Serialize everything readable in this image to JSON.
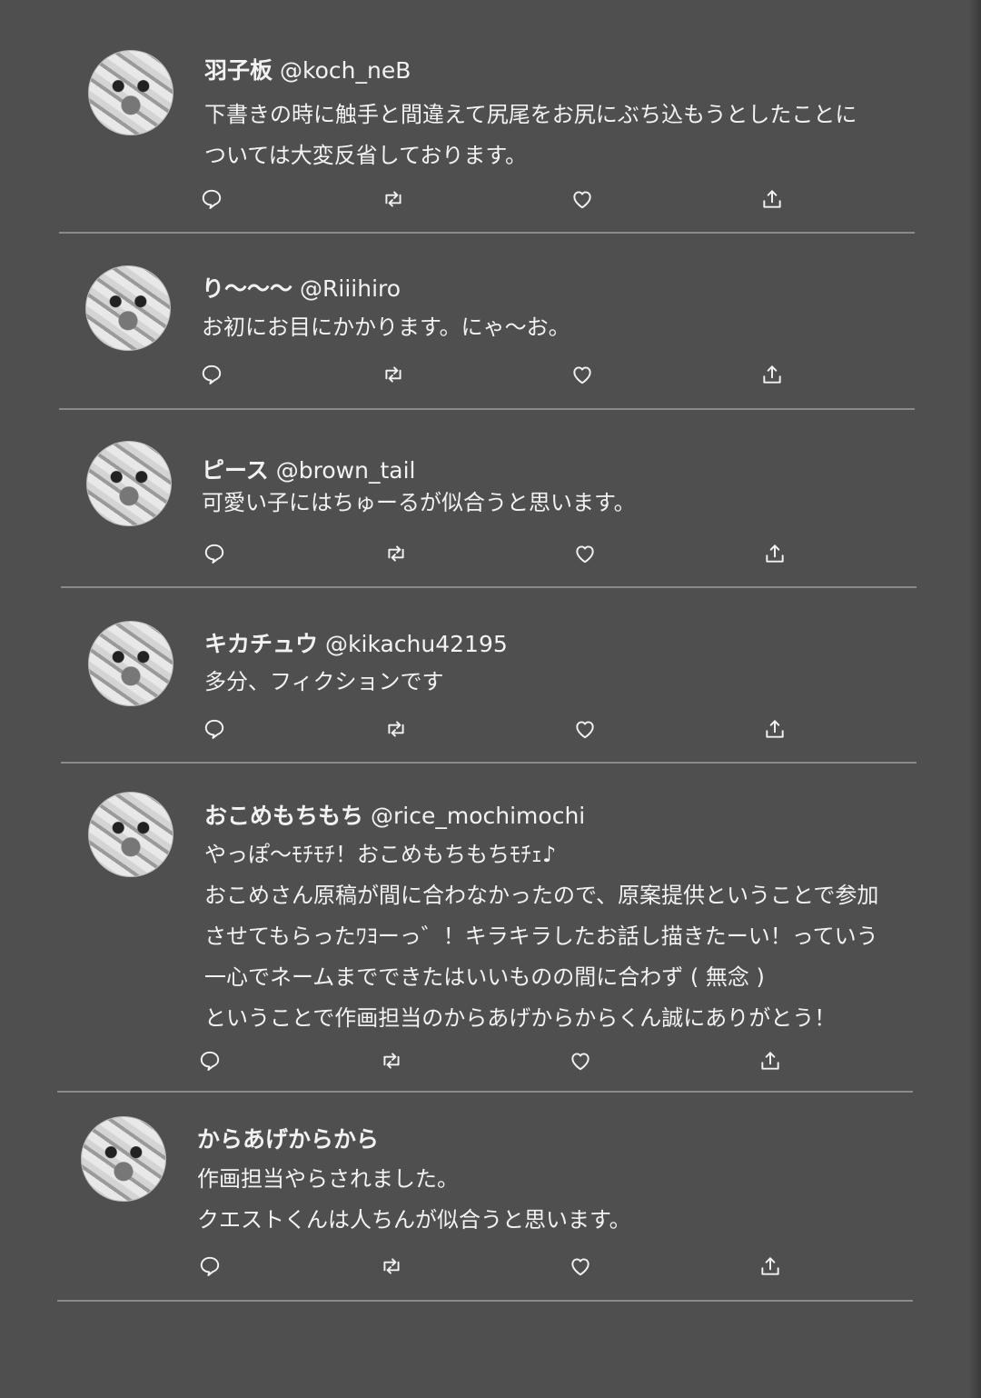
{
  "tweets": [
    {
      "name": "羽子板",
      "handle": "@koch_neB",
      "lines": [
        "下書きの時に触手と間違えて尻尾をお尻にぶち込もうとしたことに",
        "ついては大変反省しております。"
      ]
    },
    {
      "name": "り〜〜〜",
      "handle": "@Riiihiro",
      "lines": [
        "お初にお目にかかります。にゃ〜お。"
      ]
    },
    {
      "name": "ピース",
      "handle": "@brown_tail",
      "lines": [
        "可愛い子にはちゅーるが似合うと思います。"
      ]
    },
    {
      "name": "キカチュウ",
      "handle": "@kikachu42195",
      "lines": [
        "多分、フィクションです"
      ]
    },
    {
      "name": "おこめもちもち",
      "handle": "@rice_mochimochi",
      "lines": [
        "やっぽ〜ﾓﾁﾓﾁ！おこめもちもちﾓﾁｪ♪",
        "おこめさん原稿が間に合わなかったので、原案提供ということで参加",
        "させてもらったﾜﾖーっ゛！キラキラしたお話し描きたーい！っていう",
        "一心でネームまでできたはいいものの間に合わず ( 無念 )",
        "ということで作画担当のからあげからからくん誠にありがとう！"
      ]
    },
    {
      "name": "からあげからから",
      "handle": "",
      "lines": [
        "作画担当やらされました。",
        "クエストくんは人ちんが似合うと思います。"
      ]
    }
  ],
  "icons": {
    "reply": "reply-icon",
    "retweet": "retweet-icon",
    "like": "heart-icon",
    "share": "share-icon"
  },
  "colors": {
    "background": "#4f4f4f",
    "text": "#f2f2f2",
    "divider": "#8a8a8a"
  }
}
